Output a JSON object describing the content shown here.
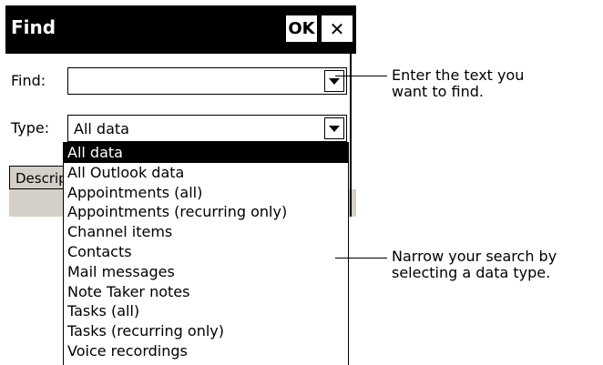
{
  "dialog": {
    "title": "Find",
    "ok_label": "OK",
    "close_glyph": "✕",
    "find_label": "Find:",
    "find_value": "",
    "type_label": "Type:",
    "type_value": "All data",
    "descr_label": "Description"
  },
  "type_options": [
    "All data",
    "All Outlook data",
    "Appointments (all)",
    "Appointments (recurring only)",
    "Channel items",
    "Contacts",
    "Mail messages",
    "Note Taker notes",
    "Tasks (all)",
    "Tasks (recurring only)",
    "Voice recordings"
  ],
  "callouts": {
    "find_line1": "Enter the text you",
    "find_line2": "want to find.",
    "type_line1": "Narrow your search by",
    "type_line2": "selecting a data type."
  }
}
